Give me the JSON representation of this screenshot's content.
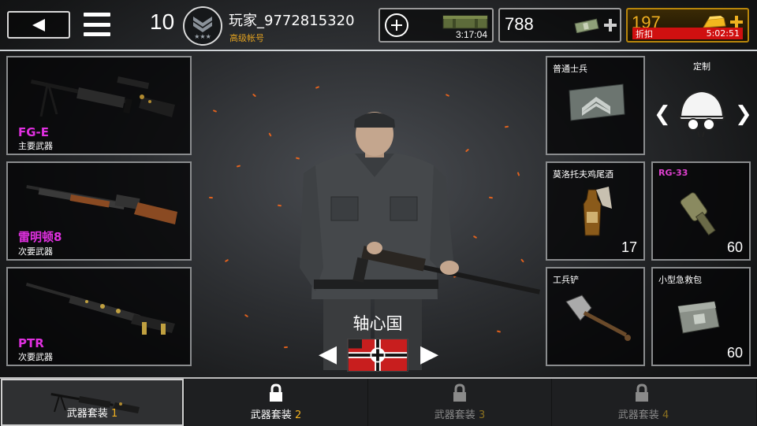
{
  "top_bar": {
    "level": "10",
    "player_name": "玩家_9772815320",
    "account_type": "高级帐号",
    "crate_timer": "3:17:04",
    "cash": "788",
    "gold": "197",
    "discount_label": "折扣",
    "discount_timer": "5:02:51"
  },
  "weapons": [
    {
      "name": "FG-E",
      "slot": "主要武器"
    },
    {
      "name": "雷明顿8",
      "slot": "次要武器"
    },
    {
      "name": "PTR",
      "slot": "次要武器"
    }
  ],
  "items": {
    "rank": {
      "label": "普通士兵"
    },
    "custom": {
      "label": "定制"
    },
    "molotov": {
      "label": "莫洛托夫鸡尾酒",
      "count": "17"
    },
    "grenade": {
      "label": "RG-33",
      "count": "60"
    },
    "shovel": {
      "label": "工兵铲"
    },
    "medkit": {
      "label": "小型急救包",
      "count": "60"
    }
  },
  "faction": {
    "name": "轴心国"
  },
  "loadout_tabs": [
    {
      "label": "武器套装",
      "number": "1",
      "locked": false,
      "active": true
    },
    {
      "label": "武器套装",
      "number": "2",
      "locked": true,
      "active": false
    },
    {
      "label": "武器套装",
      "number": "3",
      "locked": true,
      "active": false
    },
    {
      "label": "武器套装",
      "number": "4",
      "locked": true,
      "active": false
    }
  ],
  "colors": {
    "weapon_name": "#e030e0",
    "gold": "#f0b020",
    "discount": "#d01010"
  }
}
